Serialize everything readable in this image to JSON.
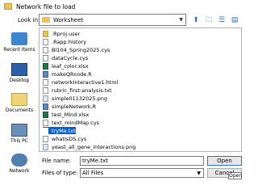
{
  "window": {
    "title": "Network file to load"
  },
  "lookin": {
    "label": "Look in:",
    "value": "Worksheet"
  },
  "places": [
    {
      "label": "Recent Items"
    },
    {
      "label": "Desktop"
    },
    {
      "label": "Documents"
    },
    {
      "label": "This PC"
    },
    {
      "label": "Network"
    }
  ],
  "files": [
    {
      "name": ".Rproj.user",
      "type": "folder"
    },
    {
      "name": ".Rapp.history",
      "type": "file"
    },
    {
      "name": "BI104_Spring2025.cys",
      "type": "file"
    },
    {
      "name": "dataCycle.cys",
      "type": "file"
    },
    {
      "name": "leaf_color.xlsx",
      "type": "xlsx"
    },
    {
      "name": "makeQRcode.R",
      "type": "r"
    },
    {
      "name": "networkInteractive1.html",
      "type": "file"
    },
    {
      "name": "rubric_first-analysis.txt",
      "type": "file"
    },
    {
      "name": "simple01132025.png",
      "type": "png"
    },
    {
      "name": "simpleNetwork.R",
      "type": "r"
    },
    {
      "name": "test_Mind.xlsx",
      "type": "xlsx"
    },
    {
      "name": "text_mindMap.cys",
      "type": "file"
    },
    {
      "name": "tryMe.txt",
      "type": "file",
      "selected": true
    },
    {
      "name": "whatIsDS.cys",
      "type": "file"
    },
    {
      "name": "yeast_all_gene_interactions.png",
      "type": "png"
    }
  ],
  "filename": {
    "label": "File name:",
    "value": "tryMe.txt"
  },
  "filetype": {
    "label": "Files of type:",
    "value": "All Files"
  },
  "buttons": {
    "open": "Open",
    "cancel": "Cancel"
  },
  "tooltip": {
    "text": "Open"
  }
}
